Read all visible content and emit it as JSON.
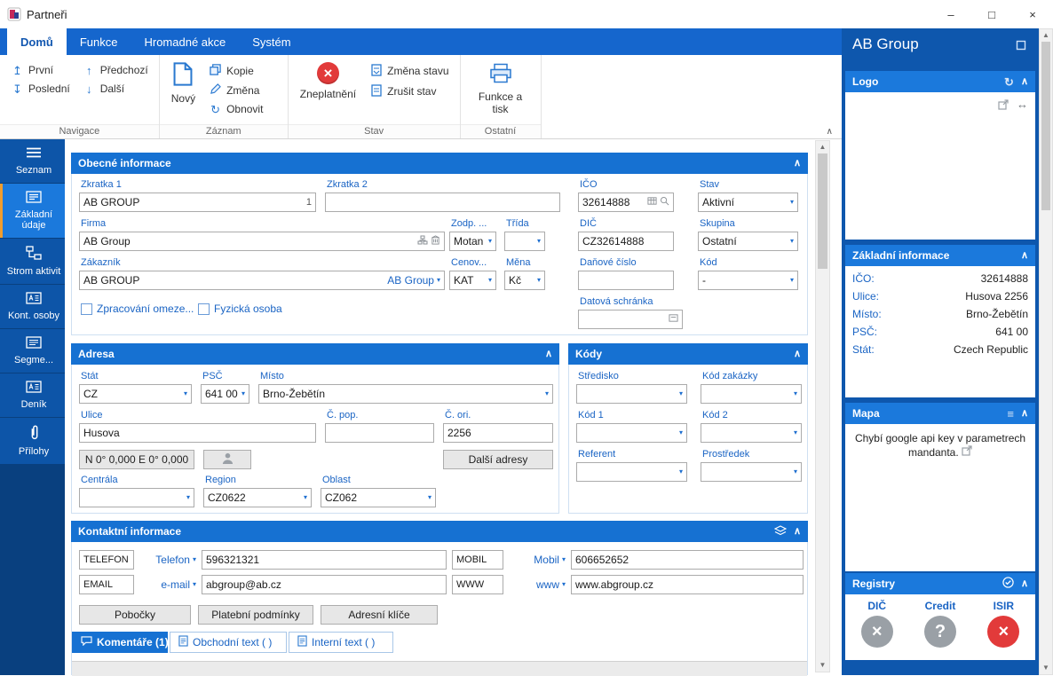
{
  "window": {
    "title": "Partneři",
    "minimize": "–",
    "maximize": "□",
    "close": "×"
  },
  "icons": {
    "chevron_up": "∧",
    "dropdown": "▾",
    "refresh": "↻",
    "arrow_up": "↑",
    "arrow_down": "↓",
    "first": "↥",
    "last": "↧",
    "hamburger": "≡",
    "external": "↗",
    "resize": "↔",
    "scroll_up": "▲",
    "scroll_down": "▼"
  },
  "colors": {
    "accent": "#1671d2",
    "panel_bg": "#0e57ad",
    "sidebar_bg": "#0c4fa0",
    "selected": "#1b79dc",
    "orange_marker": "#f09d2e",
    "danger": "#e23a3a",
    "neutral_circle": "#9aa0a6",
    "label_blue": "#1a64c4"
  },
  "ribbon": {
    "tabs": [
      {
        "label": "Domů"
      },
      {
        "label": "Funkce"
      },
      {
        "label": "Hromadné akce"
      },
      {
        "label": "Systém"
      }
    ],
    "groups": {
      "navigace": {
        "label": "Navigace",
        "first": "První",
        "last": "Poslední",
        "prev": "Předchozí",
        "next": "Další"
      },
      "zaznam": {
        "label": "Záznam",
        "new": "Nový",
        "copy": "Kopie",
        "edit": "Změna",
        "refresh": "Obnovit"
      },
      "stav": {
        "label": "Stav",
        "invalidate": "Zneplatnění",
        "change_state": "Změna stavu",
        "cancel_state": "Zrušit stav"
      },
      "ostatni": {
        "label": "Ostatní",
        "functions_print": "Funkce a tisk"
      }
    }
  },
  "sidebar": {
    "items": [
      {
        "label": "Seznam"
      },
      {
        "label": "Základní údaje"
      },
      {
        "label": "Strom aktivit"
      },
      {
        "label": "Kont. osoby"
      },
      {
        "label": "Segme..."
      },
      {
        "label": "Deník"
      },
      {
        "label": "Přílohy"
      }
    ]
  },
  "general": {
    "title": "Obecné informace",
    "zkratka1_label": "Zkratka 1",
    "zkratka1_value": "AB GROUP",
    "zkratka1_suffix": "1",
    "zkratka2_label": "Zkratka 2",
    "zkratka2_value": "",
    "ico_label": "IČO",
    "ico_value": "32614888",
    "stav_label": "Stav",
    "stav_value": "Aktivní",
    "firma_label": "Firma",
    "firma_value": "AB Group",
    "zodp_label": "Zodp. ...",
    "zodp_value": "Motan",
    "trida_label": "Třída",
    "trida_value": "",
    "dic_label": "DIČ",
    "dic_value": "CZ32614888",
    "skupina_label": "Skupina",
    "skupina_value": "Ostatní",
    "zakaznik_label": "Zákazník",
    "zakaznik_value": "AB GROUP",
    "zakaznik_link": "AB Group",
    "cenov_label": "Cenov...",
    "cenov_value": "KAT",
    "mena_label": "Měna",
    "mena_value": "Kč",
    "danove_cislo_label": "Daňové číslo",
    "danove_cislo_value": "",
    "kod_label": "Kód",
    "kod_value": "-",
    "chk_zpracovani": "Zpracování omeze...",
    "chk_fyzicka": "Fyzická osoba",
    "datova_schranka_label": "Datová schránka",
    "datova_schranka_value": ""
  },
  "adresa": {
    "title": "Adresa",
    "stat_label": "Stát",
    "stat_value": "CZ",
    "psc_label": "PSČ",
    "psc_value": "641 00",
    "misto_label": "Místo",
    "misto_value": "Brno-Žebětín",
    "ulice_label": "Ulice",
    "ulice_value": "Husova",
    "cpop_label": "Č. pop.",
    "cpop_value": "",
    "cori_label": "Č. ori.",
    "cori_value": "2256",
    "gps_value": "N 0° 0,000 E 0° 0,000",
    "dalsi_adresy": "Další adresy",
    "centrala_label": "Centrála",
    "centrala_value": "",
    "region_label": "Region",
    "region_value": "CZ0622",
    "oblast_label": "Oblast",
    "oblast_value": "CZ062"
  },
  "kody": {
    "title": "Kódy",
    "stredisko_label": "Středisko",
    "stredisko_value": "",
    "kod_zakazky_label": "Kód zakázky",
    "kod_zakazky_value": "",
    "kod1_label": "Kód 1",
    "kod1_value": "",
    "kod2_label": "Kód 2",
    "kod2_value": "",
    "referent_label": "Referent",
    "referent_value": "",
    "prostredek_label": "Prostředek",
    "prostredek_value": ""
  },
  "kontakty": {
    "title": "Kontaktní informace",
    "rows": [
      {
        "t1": "TELEFON",
        "k1": "Telefon",
        "v1": "596321321",
        "t2": "MOBIL",
        "k2": "Mobil",
        "v2": "606652652"
      },
      {
        "t1": "EMAIL",
        "k1": "e-mail",
        "v1": "abgroup@ab.cz",
        "t2": "WWW",
        "k2": "www",
        "v2": "www.abgroup.cz"
      }
    ],
    "buttons": [
      "Pobočky",
      "Platební podmínky",
      "Adresní klíče"
    ],
    "tabs": [
      {
        "label": "Komentáře (1)"
      },
      {
        "label": "Obchodní text ( )"
      },
      {
        "label": "Interní text ( )"
      }
    ]
  },
  "panel": {
    "title": "AB Group",
    "logo": {
      "title": "Logo"
    },
    "zakladni": {
      "title": "Základní informace",
      "rows": [
        {
          "label": "IČO:",
          "value": "32614888"
        },
        {
          "label": "Ulice:",
          "value": "Husova 2256"
        },
        {
          "label": "Místo:",
          "value": "Brno-Žebětín"
        },
        {
          "label": "PSČ:",
          "value": "641 00"
        },
        {
          "label": "Stát:",
          "value": "Czech Republic"
        }
      ]
    },
    "mapa": {
      "title": "Mapa",
      "message": "Chybí google api key v parametrech mandanta."
    },
    "registry": {
      "title": "Registry",
      "items": [
        {
          "label": "DIČ",
          "glyph": "×"
        },
        {
          "label": "Credit",
          "glyph": "?"
        },
        {
          "label": "ISIR",
          "glyph": "×"
        }
      ]
    }
  }
}
